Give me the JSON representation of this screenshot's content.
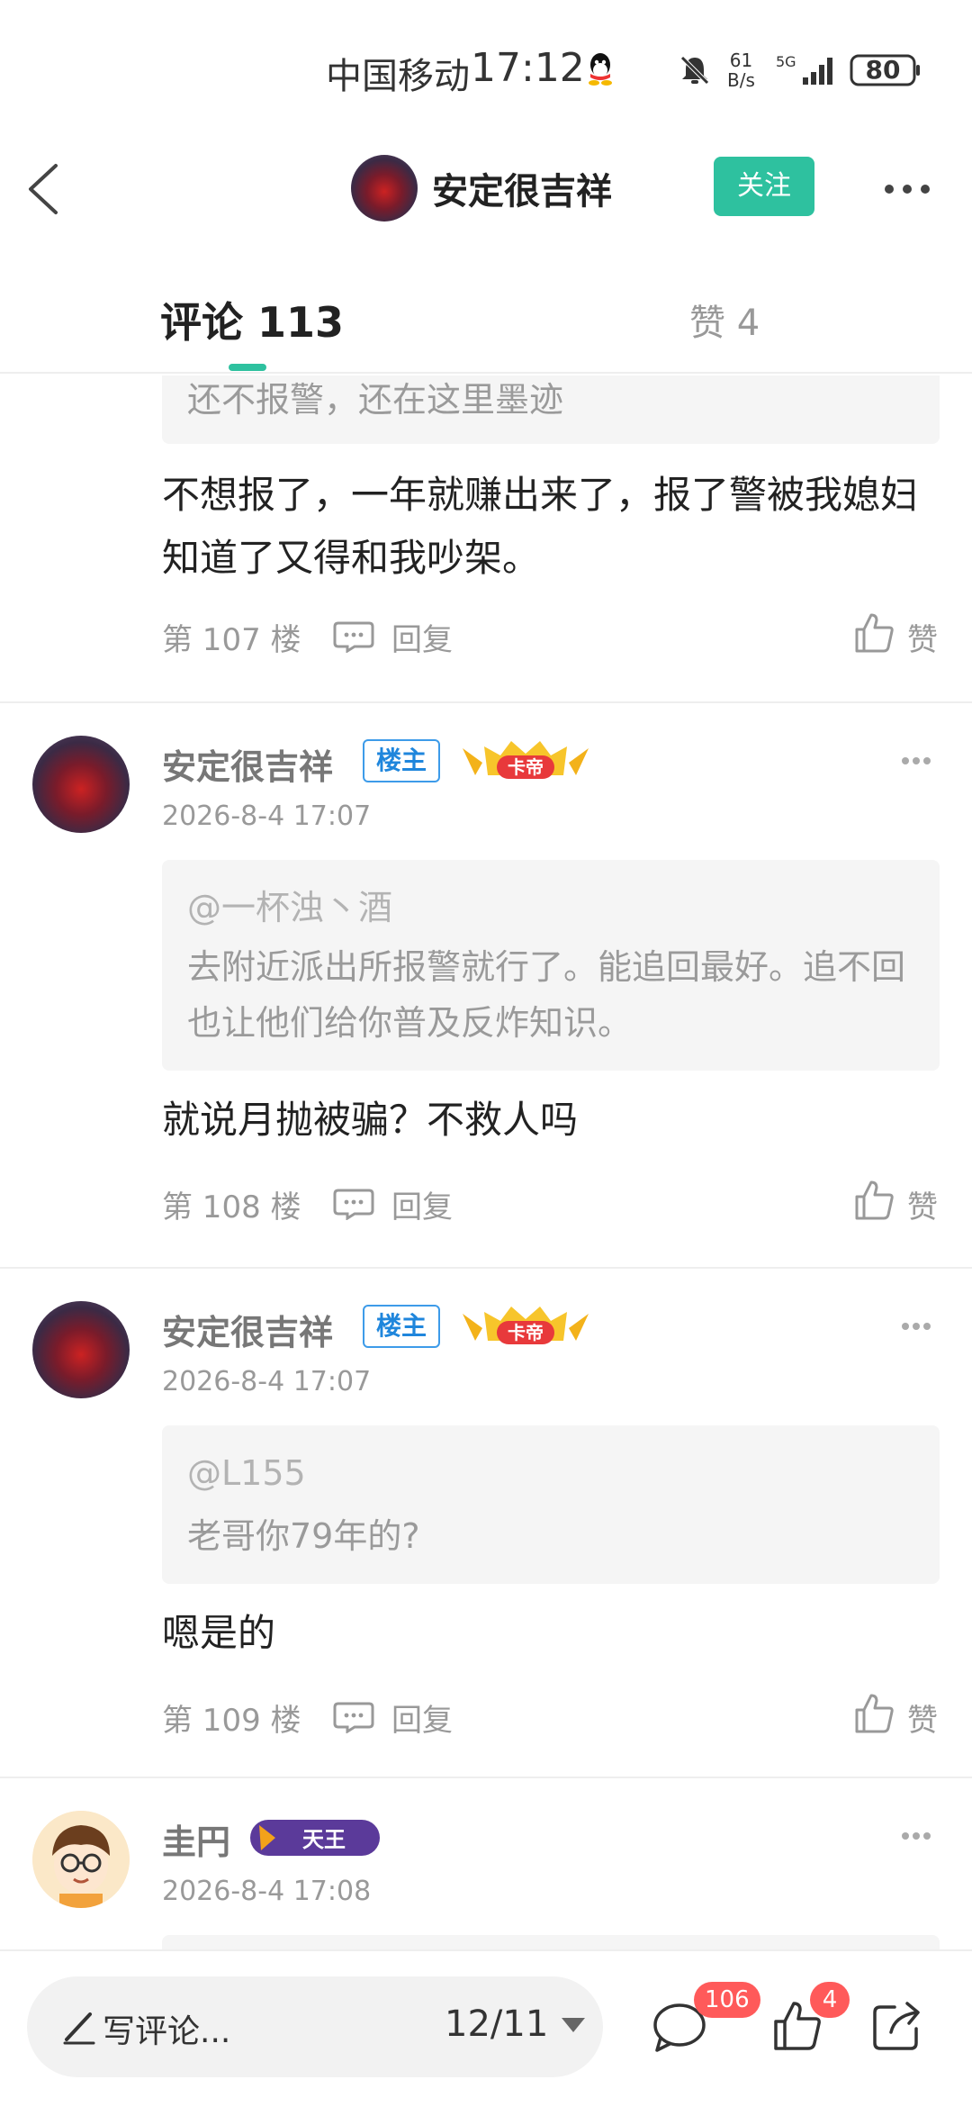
{
  "status_bar": {
    "carrier": "中国移动",
    "time": "17:12",
    "net_speed_value": "61",
    "net_speed_unit": "B/s",
    "network": "5G",
    "battery": "80"
  },
  "header": {
    "title": "安定很吉祥",
    "follow_label": "关注"
  },
  "tabs": {
    "comments_label": "评论 113",
    "likes_label": "赞 4"
  },
  "comments": [
    {
      "quote_text": "还不报警，还在这里墨迹",
      "text": "不想报了，一年就赚出来了，报了警被我媳妇知道了又得和我吵架。",
      "floor": "第 107 楼",
      "reply_label": "回复",
      "like_label": "赞"
    },
    {
      "username": "安定很吉祥",
      "op_badge": "楼主",
      "rank_badge": "卡帝",
      "timestamp": "2026-8-4 17:07",
      "quote_user": "@一杯浊丶酒",
      "quote_text": "去附近派出所报警就行了。能追回最好。追不回也让他们给你普及反炸知识。",
      "text": "就说月抛被骗？不救人吗",
      "floor": "第 108 楼",
      "reply_label": "回复",
      "like_label": "赞"
    },
    {
      "username": "安定很吉祥",
      "op_badge": "楼主",
      "rank_badge": "卡帝",
      "timestamp": "2026-8-4 17:07",
      "quote_user": "@L155",
      "quote_text": "老哥你79年的?",
      "text": "嗯是的",
      "floor": "第 109 楼",
      "reply_label": "回复",
      "like_label": "赞"
    },
    {
      "username": "圭円",
      "rank_badge": "天王",
      "timestamp": "2026-8-4 17:08"
    }
  ],
  "bottom_bar": {
    "write_label": "写评论...",
    "page_indicator": "12/11",
    "comment_count": "106",
    "like_count": "4"
  },
  "colors": {
    "accent": "#2ec19f",
    "badge_red": "#ff5a5a",
    "op_badge_blue": "#1f86dc"
  }
}
